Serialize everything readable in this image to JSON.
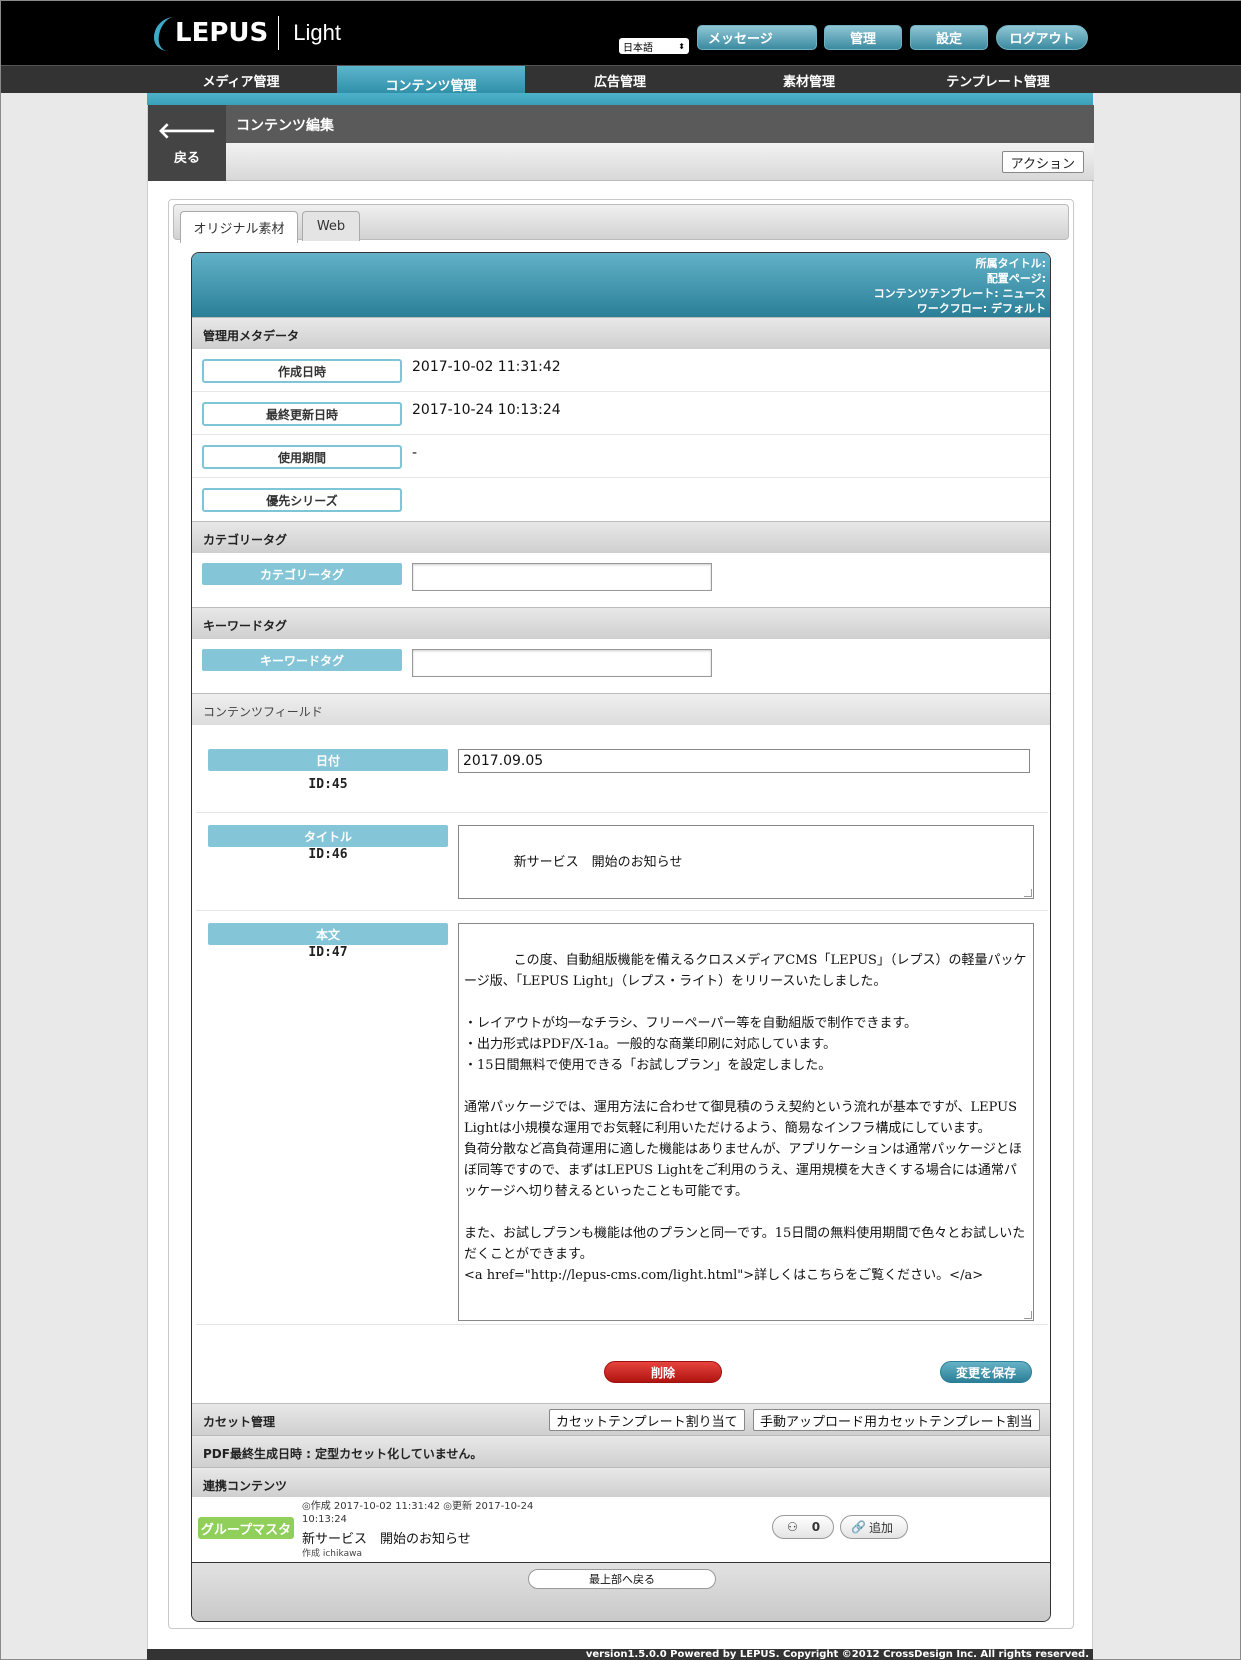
{
  "header": {
    "logo_text": "LEPUS",
    "product": "Light",
    "language": "日本語",
    "buttons": {
      "messages": "メッセージ",
      "admin": "管理",
      "settings": "設定",
      "logout": "ログアウト"
    }
  },
  "nav": [
    "メディア管理",
    "コンテンツ管理",
    "広告管理",
    "素材管理",
    "テンプレート管理"
  ],
  "page": {
    "back_label": "戻る",
    "title": "コンテンツ編集",
    "action_label": "アクション"
  },
  "tabs": [
    "オリジナル素材",
    "Web"
  ],
  "form_head": [
    "所属タイトル:",
    "配置ページ:",
    "コンテンツテンプレート: ニュース",
    "ワークフロー: デフォルト"
  ],
  "sections": {
    "meta": "管理用メタデータ",
    "category": "カテゴリータグ",
    "keyword": "キーワードタグ",
    "fields": "コンテンツフィールド",
    "cassette": "カセット管理",
    "pdf": "PDF最終生成日時 : 定型カセット化していません。",
    "related": "連携コンテンツ"
  },
  "meta": [
    {
      "label": "作成日時",
      "value": "2017-10-02 11:31:42"
    },
    {
      "label": "最終更新日時",
      "value": "2017-10-24 10:13:24"
    },
    {
      "label": "使用期間",
      "value": "-"
    },
    {
      "label": "優先シリーズ",
      "value": ""
    }
  ],
  "tags": {
    "category_label": "カテゴリータグ",
    "category_value": "",
    "keyword_label": "キーワードタグ",
    "keyword_value": ""
  },
  "fields": [
    {
      "label": "日付",
      "id": "ID:45",
      "value": "2017.09.05"
    },
    {
      "label": "タイトル",
      "id": "ID:46",
      "value": "新サービス　開始のお知らせ"
    },
    {
      "label": "本文",
      "id": "ID:47",
      "value": "この度、自動組版機能を備えるクロスメディアCMS「LEPUS」（レプス）の軽量パッケージ版、「LEPUS Light」（レプス・ライト）をリリースいたしました。\n\n・レイアウトが均一なチラシ、フリーペーパー等を自動組版で制作できます。\n・出力形式はPDF/X-1a。一般的な商業印刷に対応しています。\n・15日間無料で使用できる「お試しプラン」を設定しました。\n\n通常パッケージでは、運用方法に合わせて御見積のうえ契約という流れが基本ですが、LEPUS Lightは小規模な運用でお気軽に利用いただけるよう、簡易なインフラ構成にしています。\n負荷分散など高負荷運用に適した機能はありませんが、アプリケーションは通常パッケージとほぼ同等ですので、まずはLEPUS Lightをご利用のうえ、運用規模を大きくする場合には通常パッケージへ切り替えるといったことも可能です。\n\nまた、お試しプランも機能は他のプランと同一です。15日間の無料使用期間で色々とお試しいただくことができます。\n<a href=\"http://lepus-cms.com/light.html\">詳しくはこちらをご覧ください。</a>"
    }
  ],
  "actions": {
    "delete": "削除",
    "save": "変更を保存"
  },
  "cassette": {
    "assign": "カセットテンプレート割り当て",
    "manual_assign": "手動アップロード用カセットテンプレート割当"
  },
  "related": {
    "badge": "グループマスタ",
    "meta": "◎作成 2017-10-02 11:31:42 ◎更新 2017-10-24 10:13:24",
    "title": "新サービス　開始のお知らせ",
    "author": "作成 ichikawa",
    "count": "0",
    "add": "追加"
  },
  "back_to_top": "最上部へ戻る",
  "copyright": "version1.5.0.0 Powered by LEPUS. Copyright ©2012 CrossDesign Inc. All rights reserved."
}
